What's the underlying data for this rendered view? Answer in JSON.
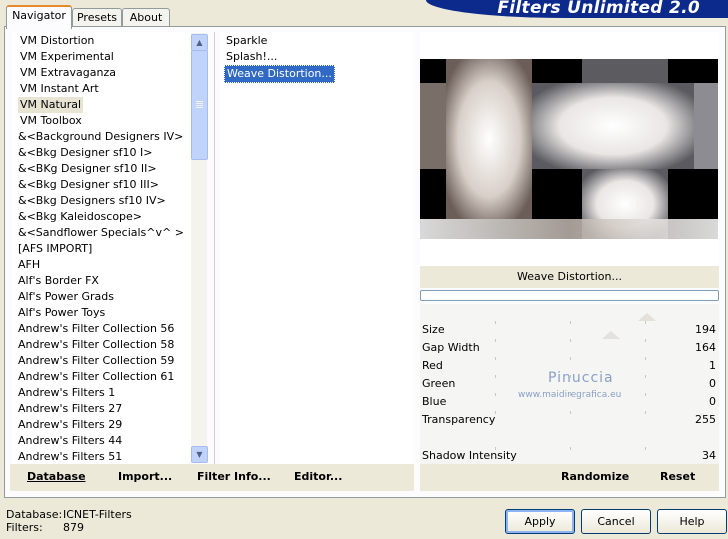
{
  "brand": {
    "title": "Filters Unlimited 2.0"
  },
  "tabs": [
    {
      "label": "Navigator"
    },
    {
      "label": "Presets"
    },
    {
      "label": "About"
    }
  ],
  "categories": [
    "VM Distortion",
    "VM Experimental",
    "VM Extravaganza",
    "VM Instant Art",
    "VM Natural",
    "VM Toolbox",
    "&<Background Designers IV>",
    "&<Bkg Designer sf10 I>",
    "&<BKg Designer sf10 II>",
    "&<Bkg Designer sf10 III>",
    "&<Bkg Designers sf10 IV>",
    "&<Bkg Kaleidoscope>",
    "&<Sandflower Specials^v^ >",
    "[AFS IMPORT]",
    "AFH",
    "Alf's Border FX",
    "Alf's Power Grads",
    "Alf's Power Toys",
    "Andrew's Filter Collection 56",
    "Andrew's Filter Collection 58",
    "Andrew's Filter Collection 59",
    "Andrew's Filter Collection 61",
    "Andrew's Filters 1",
    "Andrew's Filters 27",
    "Andrew's Filters 29",
    "Andrew's Filters 44",
    "Andrew's Filters 51"
  ],
  "selected_category": "VM Natural",
  "filters": [
    "Sparkle",
    "Splash!...",
    "Weave Distortion..."
  ],
  "selected_filter": "Weave Distortion...",
  "left_buttons": {
    "database": "Database",
    "import": "Import...",
    "filter_info": "Filter Info...",
    "editor": "Editor..."
  },
  "preview": {
    "filter_name": "Weave Distortion..."
  },
  "params": [
    {
      "label": "Size",
      "value": "194",
      "level": 0.76
    },
    {
      "label": "Gap Width",
      "value": "164",
      "level": 0.64
    },
    {
      "label": "Red",
      "value": "1"
    },
    {
      "label": "Green",
      "value": "0"
    },
    {
      "label": "Blue",
      "value": "0"
    },
    {
      "label": "Transparency",
      "value": "255"
    },
    {
      "label": "Shadow Intensity",
      "value": "34"
    }
  ],
  "watermark": {
    "name": "Pinuccia",
    "site": "www.maidiregrafica.eu"
  },
  "right_buttons": {
    "randomize": "Randomize",
    "reset": "Reset"
  },
  "footer": {
    "database_label": "Database:",
    "database_value": "ICNET-Filters",
    "filters_label": "Filters:",
    "filters_value": "879"
  },
  "dialog_buttons": {
    "apply": "Apply",
    "cancel": "Cancel",
    "help": "Help"
  },
  "colors": {
    "brand": "#0c2a8c",
    "selection": "#316ac5",
    "tab_accent": "#e68b2c"
  },
  "icons": {
    "scroll_up": "scroll-up-arrow-icon",
    "scroll_down": "scroll-down-arrow-icon"
  }
}
